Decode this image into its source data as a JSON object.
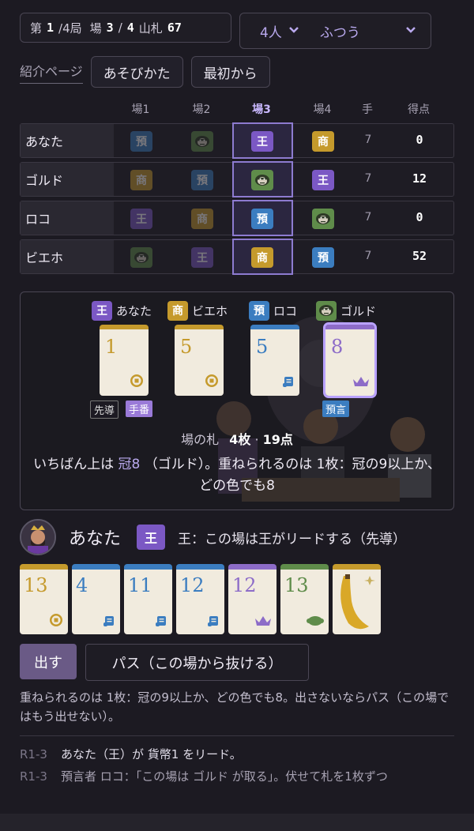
{
  "status": {
    "round_prefix": "第",
    "round": "1",
    "round_total": "/4局",
    "field_prefix": "場",
    "field": "3",
    "field_total_sep": "/",
    "field_total": "4",
    "deck_label": "山札",
    "deck": "67"
  },
  "settings": {
    "players": "4人",
    "difficulty": "ふつう"
  },
  "nav": {
    "intro": "紹介ページ",
    "how_to": "あそびかた",
    "restart": "最初から"
  },
  "table": {
    "headers": [
      "場1",
      "場2",
      "場3",
      "場4",
      "手",
      "得点"
    ],
    "active_header": 2,
    "rows": [
      {
        "name": "あなた",
        "slots": [
          [
            "預",
            "pro",
            true
          ],
          [
            "gor",
            "gor",
            true
          ],
          [
            "王",
            "king",
            false
          ],
          [
            "商",
            "mer",
            false
          ]
        ],
        "hand": "7",
        "score": "0"
      },
      {
        "name": "ゴルド",
        "slots": [
          [
            "商",
            "mer",
            true
          ],
          [
            "預",
            "pro",
            true
          ],
          [
            "gor",
            "gor",
            false
          ],
          [
            "王",
            "king",
            false
          ]
        ],
        "hand": "7",
        "score": "12"
      },
      {
        "name": "ロコ",
        "slots": [
          [
            "王",
            "king",
            true
          ],
          [
            "商",
            "mer",
            true
          ],
          [
            "預",
            "pro",
            false
          ],
          [
            "gor",
            "gor",
            false
          ]
        ],
        "hand": "7",
        "score": "0"
      },
      {
        "name": "ビエホ",
        "slots": [
          [
            "gor",
            "gor",
            true
          ],
          [
            "王",
            "king",
            true
          ],
          [
            "商",
            "mer",
            false
          ],
          [
            "預",
            "pro",
            false
          ]
        ],
        "hand": "7",
        "score": "52"
      }
    ]
  },
  "field": {
    "plays": [
      {
        "role": "王",
        "role_class": "king",
        "player": "あなた",
        "value": "1",
        "icon": "coin",
        "color": "#c59a2c",
        "chips": [
          [
            "先導",
            "outline"
          ],
          [
            "手番",
            "purple"
          ]
        ]
      },
      {
        "role": "商",
        "role_class": "mer",
        "player": "ビエホ",
        "value": "5",
        "icon": "coin",
        "color": "#c59a2c",
        "chips": []
      },
      {
        "role": "預",
        "role_class": "pro",
        "player": "ロコ",
        "value": "5",
        "icon": "scroll",
        "color": "#3b7dc0",
        "chips": []
      },
      {
        "role": "gor",
        "role_class": "gor",
        "player": "ゴルド",
        "value": "8",
        "icon": "crown",
        "color": "#8d6cc8",
        "chips": [
          [
            "預言",
            "blue"
          ]
        ],
        "selected": true
      }
    ],
    "summary_label": "場の札",
    "summary_count": "4枚",
    "summary_sep": "·",
    "summary_points": "19点",
    "msg_a": "いちばん上は",
    "msg_hl": "冠8",
    "msg_b": "（ゴルド）。重ねられるのは 1枚：冠の9以上か、どの色でも8"
  },
  "me": {
    "name": "あなた",
    "role": "王",
    "role_desc": "王：この場は王がリードする（先導）"
  },
  "hand": [
    {
      "value": "13",
      "color": "#c59a2c",
      "icon": "coin"
    },
    {
      "value": "4",
      "color": "#3b7dc0",
      "icon": "scroll"
    },
    {
      "value": "11",
      "color": "#3b7dc0",
      "icon": "scroll"
    },
    {
      "value": "12",
      "color": "#3b7dc0",
      "icon": "scroll"
    },
    {
      "value": "12",
      "color": "#8d6cc8",
      "icon": "crown"
    },
    {
      "value": "13",
      "color": "#5f8c4a",
      "icon": "gorilla"
    },
    {
      "value": "",
      "color": "#c59a2c",
      "icon": "banana"
    }
  ],
  "actions": {
    "play": "出す",
    "pass": "パス（この場から抜ける）"
  },
  "hint": "重ねられるのは 1枚：冠の9以上か、どの色でも8。出さないならパス（この場ではもう出せない）。",
  "log": [
    {
      "round": "R1-3",
      "text": "あなた（王）が 貨幣1 をリード。"
    },
    {
      "round": "R1-3",
      "text": "預言者 ロコ：「この場は ゴルド が取る」。伏せて札を1枚ずつ"
    }
  ],
  "icons": {
    "chevron": "chevron-down-icon",
    "coin": "coin-icon",
    "scroll": "scroll-icon",
    "crown": "crown-icon",
    "gorilla": "gorilla-icon",
    "banana": "banana-icon"
  },
  "colors": {
    "king": "#7b58c4",
    "merchant": "#c59a2c",
    "prophet": "#3b7dc0",
    "gorilla": "#5f8c4a",
    "accent": "#b9a9ee"
  }
}
